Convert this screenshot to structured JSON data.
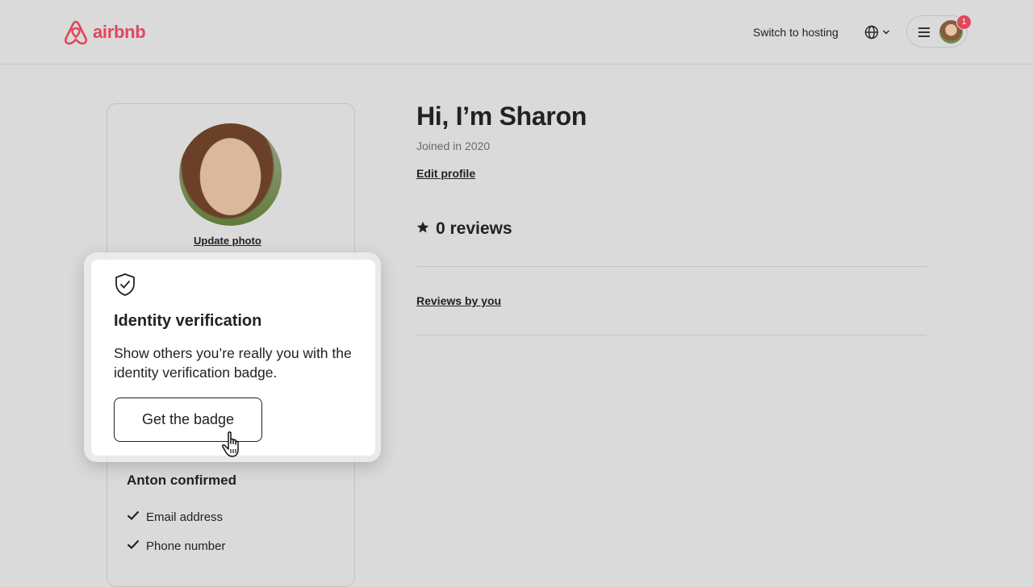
{
  "header": {
    "logo_text": "airbnb",
    "switch_hosting": "Switch to hosting",
    "notification_count": "1"
  },
  "colors": {
    "brand": "#e0475b",
    "background": "#dadada",
    "text": "#222222"
  },
  "icons": {
    "logo": "airbnb-logo-icon",
    "language": "globe-icon",
    "language_dropdown": "chevron-down-icon",
    "menu": "hamburger-menu-icon",
    "verification": "shield-check-icon",
    "reviews": "star-icon",
    "confirmed": "checkmark-icon",
    "pointer": "hand-cursor-icon"
  },
  "profile_card": {
    "update_photo": "Update photo",
    "confirmed_title": "Anton confirmed",
    "confirmed_items": [
      "Email address",
      "Phone number"
    ]
  },
  "popover": {
    "title": "Identity verification",
    "text": "Show others you’re really you with the identity verification badge.",
    "button_label": "Get the badge"
  },
  "main": {
    "greeting": "Hi, I’m Sharon",
    "joined": "Joined in 2020",
    "edit_profile": "Edit profile",
    "reviews_count": "0 reviews",
    "reviews_by_you": "Reviews by you"
  }
}
